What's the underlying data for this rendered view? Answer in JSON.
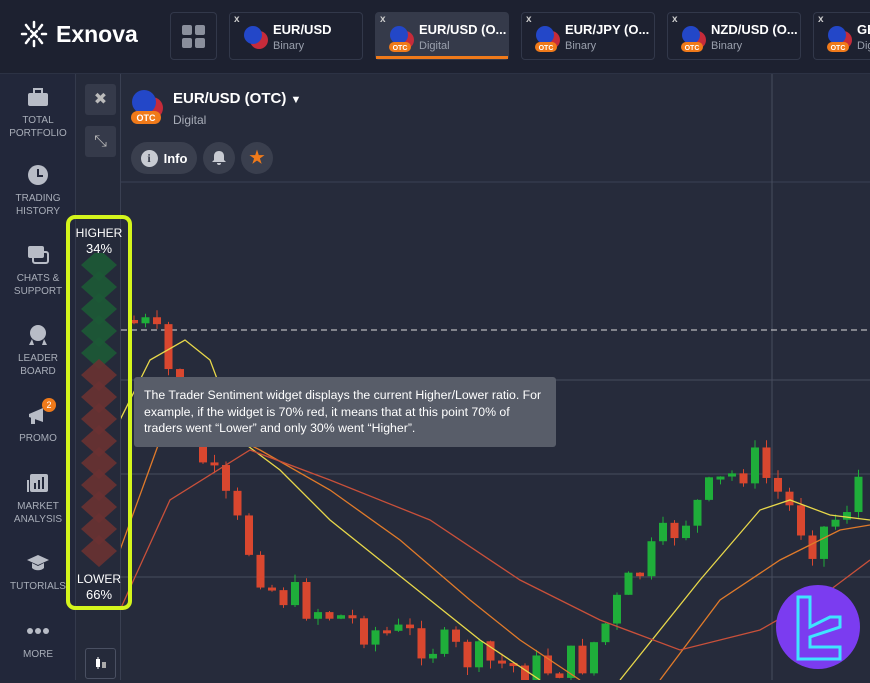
{
  "header": {
    "logo": "Exnova",
    "tabs": [
      {
        "name": "EUR/USD",
        "type": "Binary",
        "otc": false,
        "active": false
      },
      {
        "name": "EUR/USD (O...",
        "type": "Digital",
        "otc": true,
        "active": true
      },
      {
        "name": "EUR/JPY (O...",
        "type": "Binary",
        "otc": true,
        "active": false
      },
      {
        "name": "NZD/USD (O...",
        "type": "Binary",
        "otc": true,
        "active": false
      },
      {
        "name": "GE",
        "type": "Dig",
        "otc": true,
        "active": false
      }
    ],
    "close": "x"
  },
  "sidebar": {
    "items": [
      {
        "icon": "briefcase-icon",
        "label1": "TOTAL",
        "label2": "PORTFOLIO"
      },
      {
        "icon": "clock-icon",
        "label1": "TRADING",
        "label2": "HISTORY"
      },
      {
        "icon": "chat-icon",
        "label1": "CHATS &",
        "label2": "SUPPORT"
      },
      {
        "icon": "medal-icon",
        "label1": "LEADER",
        "label2": "BOARD"
      },
      {
        "icon": "megaphone-icon",
        "label1": "PROMO",
        "label2": "",
        "badge": "2"
      },
      {
        "icon": "bar-chart-icon",
        "label1": "MARKET",
        "label2": "ANALYSIS"
      },
      {
        "icon": "graduation-cap-icon",
        "label1": "TUTORIALS",
        "label2": ""
      },
      {
        "icon": "more-icon",
        "label1": "MORE",
        "label2": ""
      }
    ]
  },
  "asset": {
    "title": "EUR/USD (OTC)",
    "type": "Digital",
    "otc_badge": "OTC",
    "info_label": "Info"
  },
  "sentiment": {
    "higher_label": "HIGHER",
    "higher_pct": "34%",
    "lower_label": "LOWER",
    "lower_pct": "66%",
    "higher_value": 34,
    "lower_value": 66
  },
  "tooltip": {
    "text": "The Trader Sentiment widget displays the current Higher/Lower ratio. For example, if the widget is 70% red, it means that at this point 70% of traders went “Lower” and only 30% went “Higher”."
  },
  "colors": {
    "accent": "#f07a1a",
    "up": "#1fae3a",
    "down": "#d9472f",
    "highlight": "#d4f51c",
    "brand": "#7b3cf0"
  }
}
